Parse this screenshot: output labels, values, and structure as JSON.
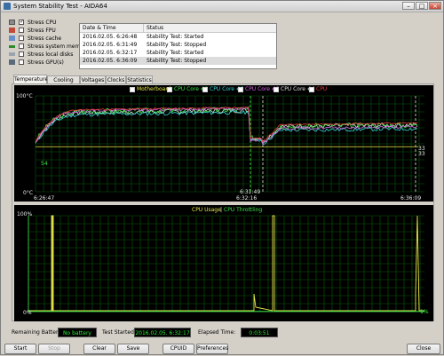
{
  "window": {
    "title": "System Stability Test - AIDA64"
  },
  "stress_options": [
    {
      "label": "Stress CPU",
      "checked": true,
      "icon": "cpu-icon"
    },
    {
      "label": "Stress FPU",
      "checked": false,
      "icon": "fpu-icon"
    },
    {
      "label": "Stress cache",
      "checked": false,
      "icon": "cache-icon"
    },
    {
      "label": "Stress system memory",
      "checked": false,
      "icon": "memory-icon"
    },
    {
      "label": "Stress local disks",
      "checked": false,
      "icon": "disk-icon"
    },
    {
      "label": "Stress GPU(s)",
      "checked": false,
      "icon": "gpu-icon"
    }
  ],
  "log": {
    "col_datetime": "Date & Time",
    "col_status": "Status",
    "rows": [
      {
        "datetime": "2016.02.05. 6:26:48",
        "status": "Stability Test: Started"
      },
      {
        "datetime": "2016.02.05. 6:31:49",
        "status": "Stability Test: Stopped"
      },
      {
        "datetime": "2016.02.05. 6:32:17",
        "status": "Stability Test: Started"
      },
      {
        "datetime": "2016.02.05. 6:36:09",
        "status": "Stability Test: Stopped"
      }
    ]
  },
  "tabs": [
    "Temperatures",
    "Cooling Fans",
    "Voltages",
    "Clocks",
    "Statistics"
  ],
  "temp_graph": {
    "legend": [
      {
        "label": "Motherboard",
        "color": "#e8e84a"
      },
      {
        "label": "CPU Core #1",
        "color": "#3ee84a"
      },
      {
        "label": "CPU Core #2",
        "color": "#38d8d8"
      },
      {
        "label": "CPU Core #3",
        "color": "#d860e8"
      },
      {
        "label": "CPU Core #4",
        "color": "#e0e0e0"
      },
      {
        "label": "CPU",
        "color": "#e83a3a"
      }
    ],
    "y_top": "100°C",
    "y_bottom": "0°C",
    "time_labels": [
      "6:26:47",
      "6:32:16",
      "6:31:49",
      "6:36:09"
    ],
    "left_value": "54",
    "right_values": [
      "33",
      "33"
    ]
  },
  "usage_graph": {
    "legend": [
      "CPU Usage",
      "CPU Throttling"
    ],
    "legend_sep": "|",
    "y_top": "100%",
    "y_bottom": "0%",
    "right_value": "1%"
  },
  "status_bar": {
    "battery_label": "Remaining Battery:",
    "battery_value": "No battery",
    "started_label": "Test Started:",
    "started_value": "2016.02.05. 6:32:17",
    "elapsed_label": "Elapsed Time:",
    "elapsed_value": "0:03:51"
  },
  "buttons": {
    "start": "Start",
    "stop": "Stop",
    "clear": "Clear",
    "save": "Save",
    "cpuid": "CPUID",
    "preferences": "Preferences",
    "close": "Close"
  }
}
